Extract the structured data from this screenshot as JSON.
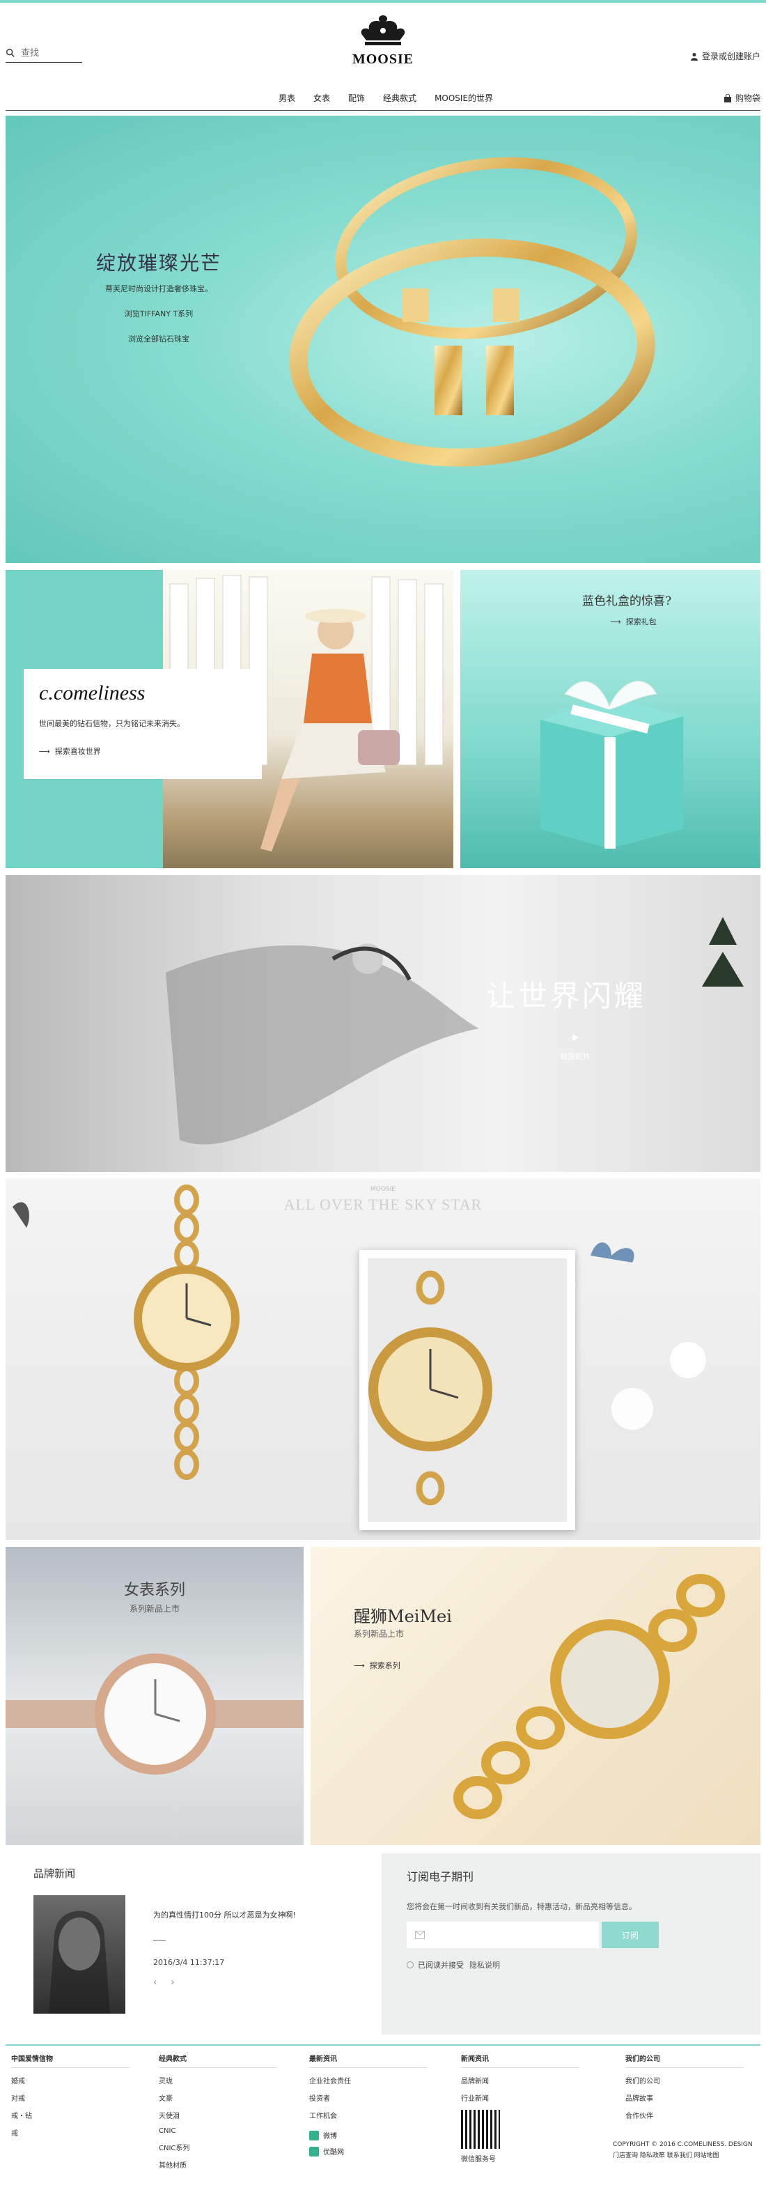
{
  "header": {
    "search": {
      "value": "",
      "placeholder": "查找"
    },
    "logo_text": "MOOSIE",
    "account_label": "登录或创建账户",
    "nav": [
      "男表",
      "女表",
      "配饰",
      "经典款式",
      "MOOSIE的世界"
    ],
    "cart_label": "购物袋"
  },
  "hero": {
    "title": "绽放璀璨光芒",
    "subtitle": "蒂芙尼时尚设计打造奢侈珠宝。",
    "link1": "浏览TIFFANY T系列",
    "link2": "浏览全部钻石珠宝"
  },
  "promo_left": {
    "title": "c.comeliness",
    "text": "世间最美的钻石信物，只为铭记未来消失。",
    "link": "探索喜妆世界"
  },
  "promo_right": {
    "title": "蓝色礼盒的惊喜?",
    "link": "探索礼包"
  },
  "banner3": {
    "title": "让世界闪耀",
    "link": "观赏影片"
  },
  "banner4": {
    "heading": "ALL OVER THE SKY STAR",
    "label_top": "MOOSIE"
  },
  "seriesA": {
    "title": "女表系列",
    "subtitle": "系列新品上市"
  },
  "seriesB": {
    "title": "醒狮MeiMei",
    "subtitle": "系列新品上市",
    "link": "探索系列"
  },
  "news": {
    "heading": "品牌新闻",
    "item_title": "为的真性情打100分 所以才恶是为女神啊!",
    "item_date": "2016/3/4  11:37:17",
    "pager": "‹ ›"
  },
  "subscribe": {
    "heading": "订阅电子期刊",
    "text": "您将会在第一时间收到有关我们新品，特惠活动，新品亮相等信息。",
    "email_placeholder": "",
    "button": "订阅",
    "agree": "已阅读并接受",
    "privacy": "隐私说明"
  },
  "footer": {
    "cols": [
      {
        "heading": "中国爱情信物",
        "items": [
          "婚戒",
          "对戒",
          "戒・钻",
          "戒"
        ]
      },
      {
        "heading": "经典款式",
        "items": [
          "灵珑",
          "文豪",
          "天使泪",
          "CNIC",
          "CNIC系列",
          "其他材质"
        ]
      },
      {
        "heading": "最新资讯",
        "items": [
          "企业社会责任",
          "投资者",
          "工作机会"
        ],
        "social": [
          "微博",
          "优酷网"
        ]
      },
      {
        "heading": "新闻资讯",
        "items": [
          "品牌新闻",
          "行业新闻"
        ],
        "qr_label": "微信服务号"
      },
      {
        "heading": "我们的公司",
        "items": [
          "我们的公司",
          "品牌故事",
          "合作伙伴"
        ]
      }
    ],
    "copyright": "COPYRIGHT © 2016 C.COMELINESS. DESIGN",
    "links": "门店查询  隐私政策  联系我们  网站地图"
  },
  "colors": {
    "accent": "#80d8cd",
    "button": "#8fd9cf"
  }
}
